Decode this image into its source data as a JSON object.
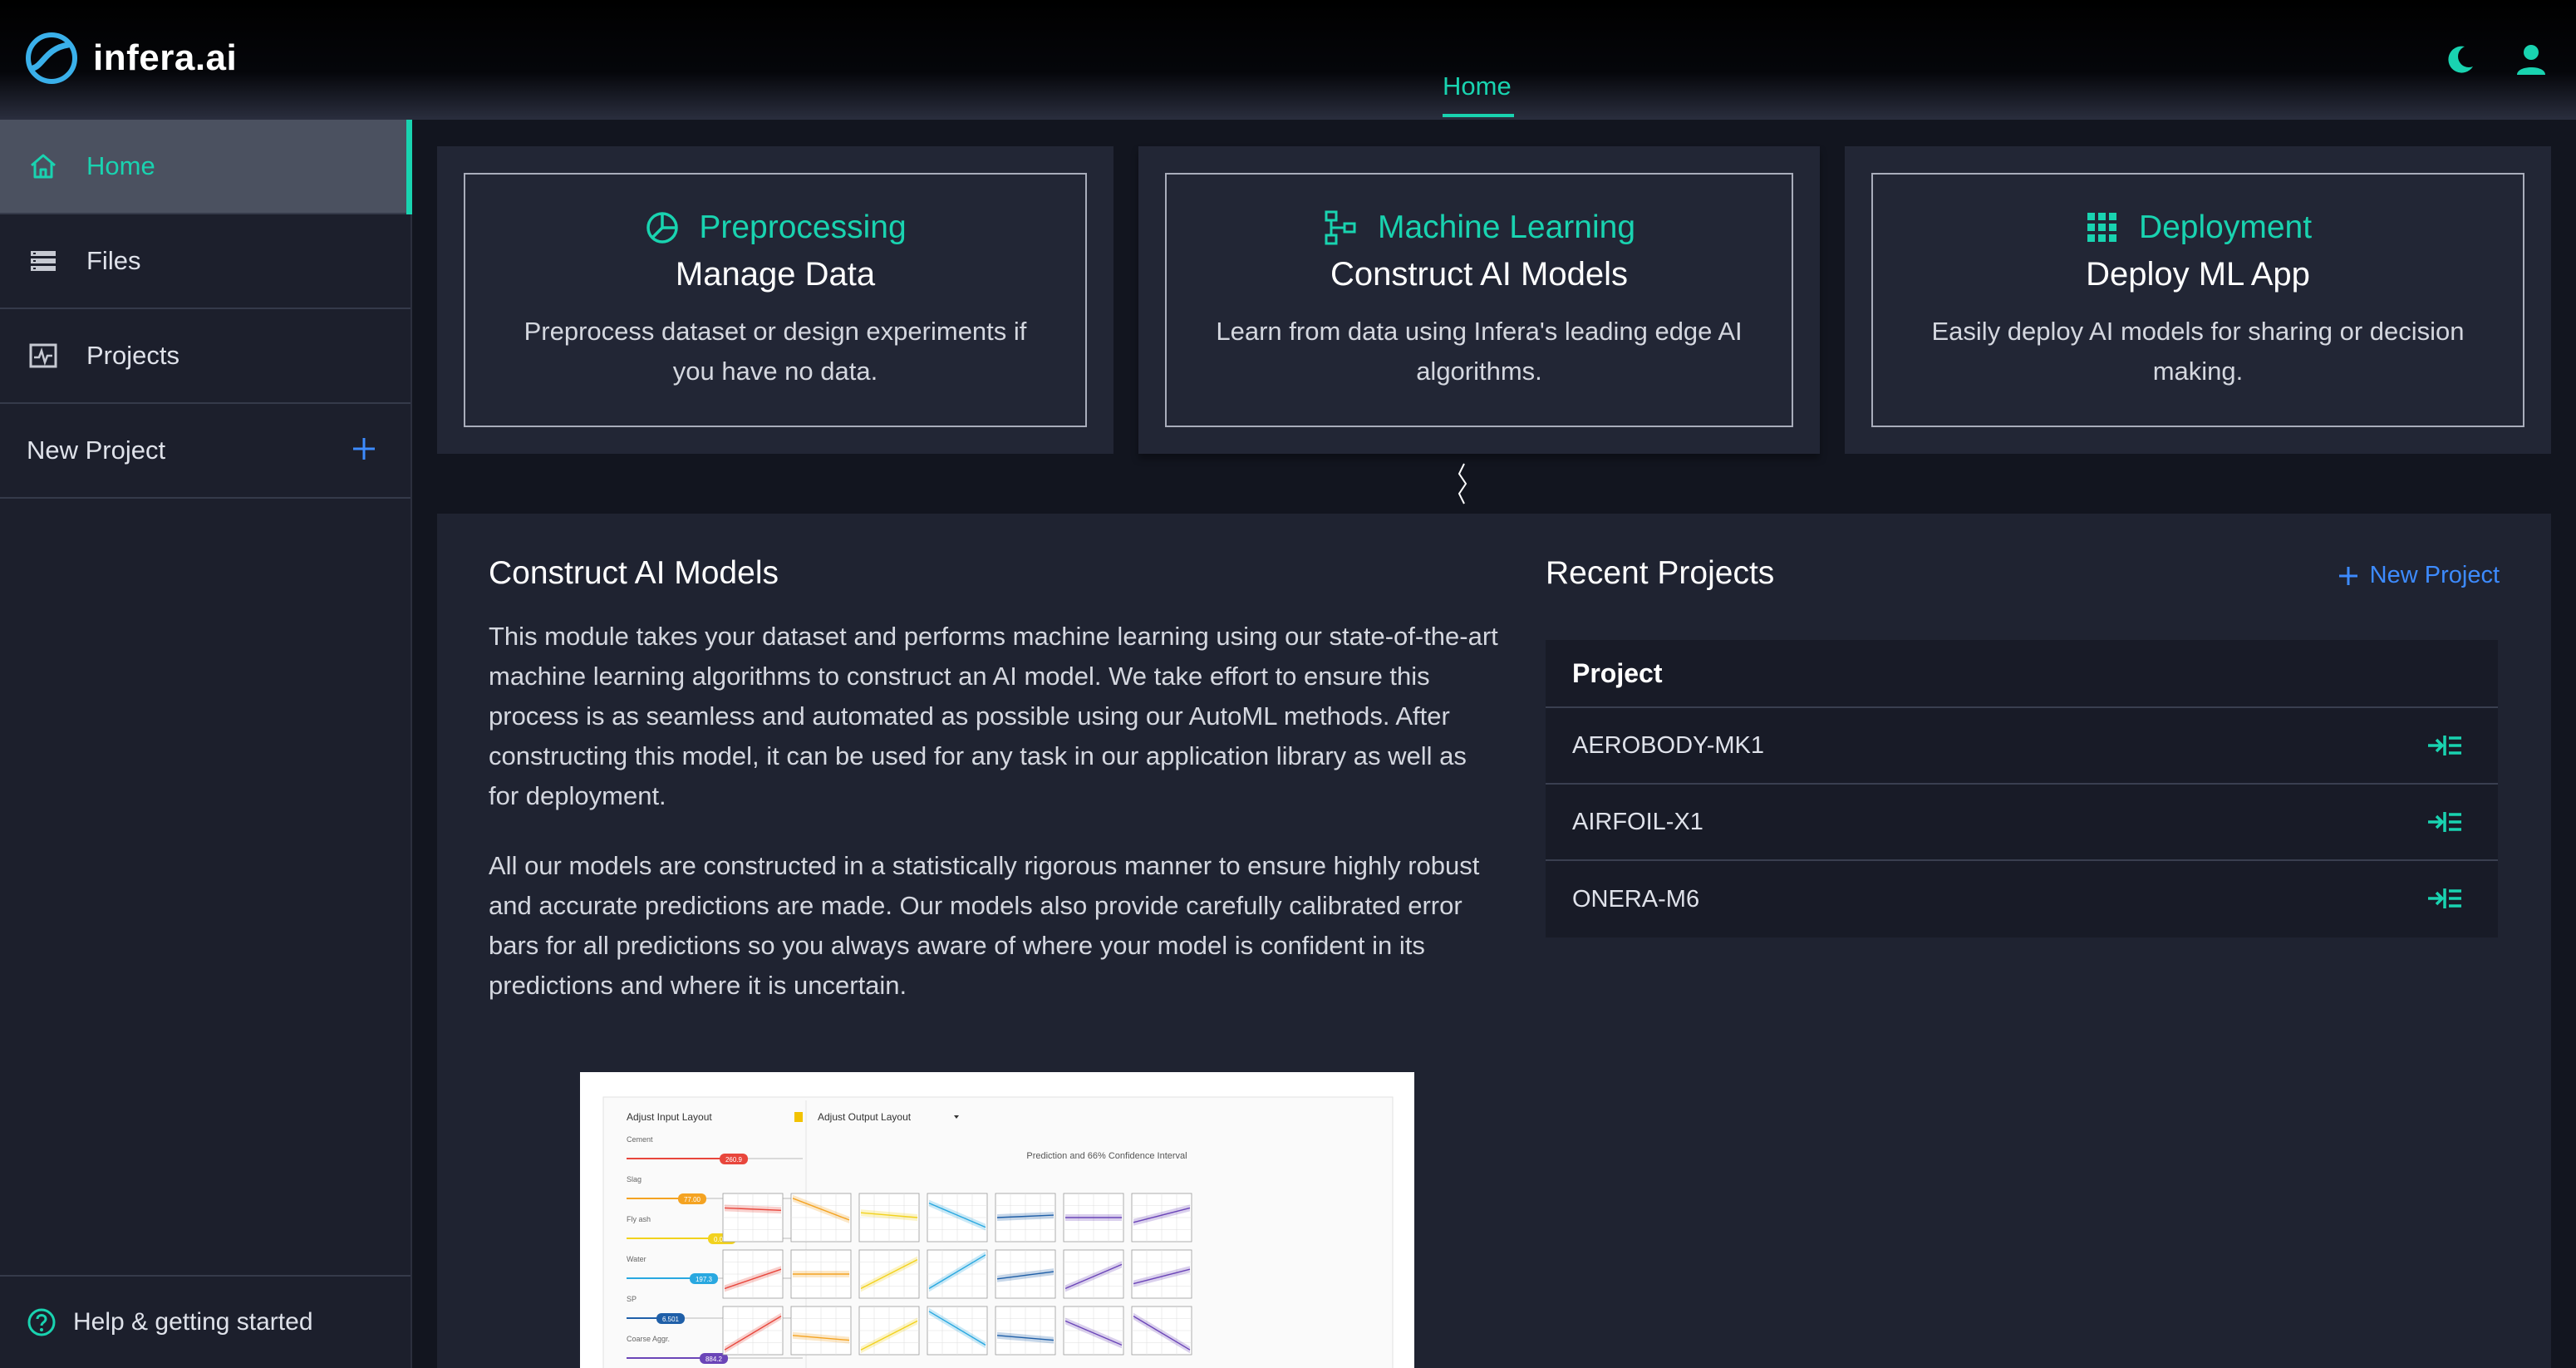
{
  "header": {
    "logo_text": "infera.ai",
    "nav_home": "Home",
    "accent": "#19d3b0"
  },
  "sidebar": {
    "items": [
      {
        "label": "Home",
        "icon": "home-icon"
      },
      {
        "label": "Files",
        "icon": "files-icon"
      },
      {
        "label": "Projects",
        "icon": "projects-icon"
      }
    ],
    "new_project": "New Project",
    "help": "Help & getting started"
  },
  "modules": [
    {
      "category": "Preprocessing",
      "title": "Manage Data",
      "description": "Preprocess dataset or design experiments if you have no data.",
      "icon": "preprocessing-icon"
    },
    {
      "category": "Machine Learning",
      "title": "Construct AI Models",
      "description": "Learn from data using Infera's leading edge AI algorithms.",
      "icon": "machine-learning-icon"
    },
    {
      "category": "Deployment",
      "title": "Deploy ML App",
      "description": "Easily deploy AI models for sharing or decision making.",
      "icon": "deployment-icon"
    }
  ],
  "main": {
    "title": "Construct AI Models",
    "paragraph1": "This module takes your dataset and performs machine learning using our state-of-the-art machine learning algorithms to construct an AI model. We take effort to ensure this process is as seamless and automated as possible using our AutoML methods. After constructing this model, it can be used for any task in our application library as well as for deployment.",
    "paragraph2": "All our models are constructed in a statistically rigorous manner to ensure highly robust and accurate predictions are made. Our models also provide carefully calibrated error bars for all predictions so you always aware of where your model is confident in its predictions and where it is uncertain."
  },
  "preview": {
    "input_layout": "Adjust Input Layout",
    "output_layout": "Adjust Output Layout",
    "chart_title": "Prediction and 66% Confidence Interval",
    "inputs": [
      {
        "label": "Cement",
        "value": "260.9",
        "color": "#e8463c"
      },
      {
        "label": "Slag",
        "value": "77.00",
        "color": "#f4a322"
      },
      {
        "label": "Fly ash",
        "value": "0.000",
        "color": "#f2d21e"
      },
      {
        "label": "Water",
        "value": "197.3",
        "color": "#29a8e0"
      },
      {
        "label": "SP",
        "value": "6.501",
        "color": "#1f5fa8"
      },
      {
        "label": "Coarse Aggr.",
        "value": "884.2",
        "color": "#6b45b8"
      }
    ]
  },
  "recent": {
    "title": "Recent Projects",
    "new_label": "New Project",
    "column": "Project",
    "rows": [
      "AEROBODY-MK1",
      "AIRFOIL-X1",
      "ONERA-M6"
    ]
  }
}
